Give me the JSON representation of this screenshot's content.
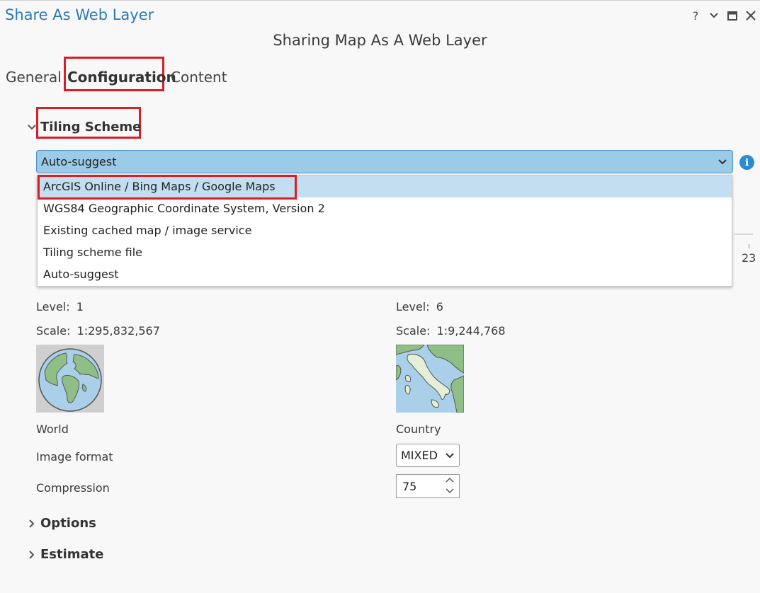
{
  "window": {
    "title": "Share As Web Layer",
    "help_label": "?",
    "pane_heading": "Sharing Map As A Web Layer"
  },
  "tabs": [
    {
      "label": "General",
      "active": false
    },
    {
      "label": "Configuration",
      "active": true
    },
    {
      "label": "Content",
      "active": false
    }
  ],
  "tiling_scheme": {
    "section_label": "Tiling Scheme",
    "selected_value": "Auto-suggest",
    "options": [
      "ArcGIS Online / Bing Maps / Google Maps",
      "WGS84 Geographic Coordinate System, Version 2",
      "Existing cached map / image service",
      "Tiling scheme file",
      "Auto-suggest"
    ],
    "highlighted_option_index": 0
  },
  "scale_slider": {
    "max_level": "23"
  },
  "min_level": {
    "level_label": "Level:",
    "level_value": "1",
    "scale_label": "Scale:",
    "scale_value": "1:295,832,567",
    "name": "World"
  },
  "max_level": {
    "level_label": "Level:",
    "level_value": "6",
    "scale_label": "Scale:",
    "scale_value": "1:9,244,768",
    "name": "Country"
  },
  "image_format": {
    "label": "Image format",
    "value": "MIXED"
  },
  "compression": {
    "label": "Compression",
    "value": "75"
  },
  "sections": {
    "options_label": "Options",
    "estimate_label": "Estimate"
  },
  "colors": {
    "accent": "#2a7ab8",
    "highlight_box": "#d91f26",
    "combo_bg": "#9ccbe8",
    "selected_option_bg": "#c3def0"
  }
}
